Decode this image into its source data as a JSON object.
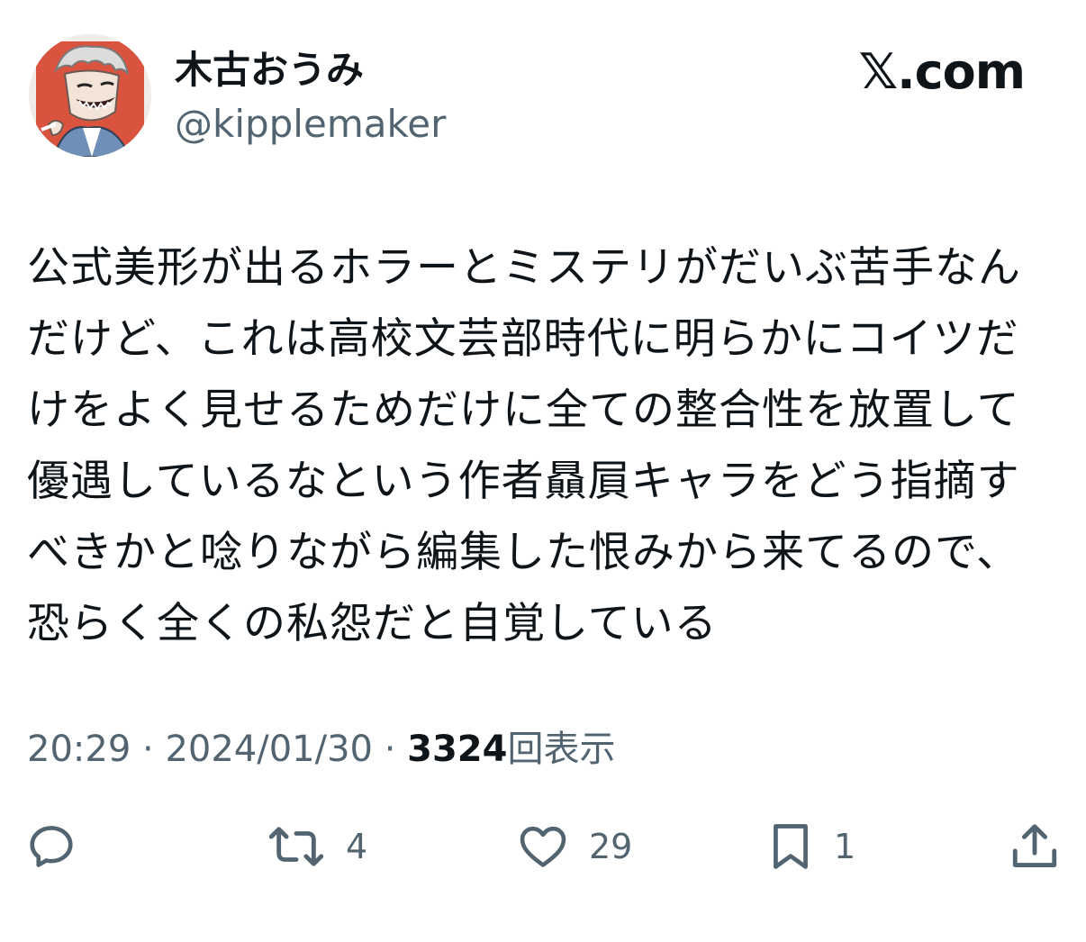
{
  "author": {
    "display_name": "木古おうみ",
    "handle": "@kipplemaker",
    "avatar_icon": "avatar-illustration"
  },
  "brand": {
    "label": "𝕏.com"
  },
  "tweet": {
    "text": "公式美形が出るホラーとミステリがだいぶ苦手なんだけど、これは高校文芸部時代に明らかにコイツだけをよく見せるためだけに全ての整合性を放置して優遇しているなという作者贔屓キャラをどう指摘すべきかと唸りながら編集した恨みから来てるので、恐らく全くの私怨だと自覚している"
  },
  "meta": {
    "time": "20:29",
    "separator": " · ",
    "date": "2024/01/30",
    "views_count": "3324",
    "views_label": "回表示"
  },
  "actions": {
    "reply": {
      "icon": "reply-icon",
      "count": ""
    },
    "repost": {
      "icon": "repost-icon",
      "count": "4"
    },
    "like": {
      "icon": "heart-icon",
      "count": "29"
    },
    "bookmark": {
      "icon": "bookmark-icon",
      "count": "1"
    },
    "share": {
      "icon": "share-icon",
      "count": ""
    }
  },
  "colors": {
    "text_primary": "#0f1419",
    "text_secondary": "#536471",
    "avatar_bg": "#d9533f"
  }
}
